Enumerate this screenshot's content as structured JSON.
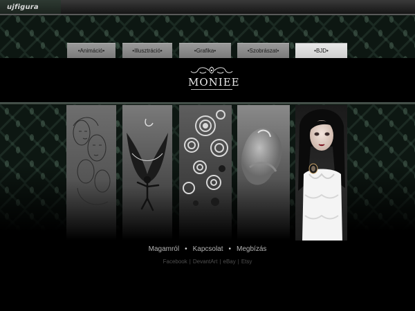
{
  "site": {
    "logo_text": "ujfigura"
  },
  "nav": [
    {
      "label": "•Animáció•"
    },
    {
      "label": "•Illusztráció•"
    },
    {
      "label": "•Grafika•"
    },
    {
      "label": "•Szobrászat•"
    },
    {
      "label": "•BJD•"
    }
  ],
  "brand": {
    "name": "MONIEE"
  },
  "footer": {
    "links": [
      {
        "label": "Magamról"
      },
      {
        "label": "Kapcsolat"
      },
      {
        "label": "Megbízás"
      }
    ],
    "separator": "•",
    "social": [
      {
        "label": "Facebook"
      },
      {
        "label": "DevantArt"
      },
      {
        "label": "eBay"
      },
      {
        "label": "Etsy"
      }
    ],
    "social_separator": "|"
  },
  "colors": {
    "background": "#000000",
    "damask": "#0d1712",
    "tab_inactive": "#8a8a8a",
    "tab_active": "#dcdcdc",
    "footer_text": "#b5b5b5",
    "social_text": "#4e4e4e"
  }
}
